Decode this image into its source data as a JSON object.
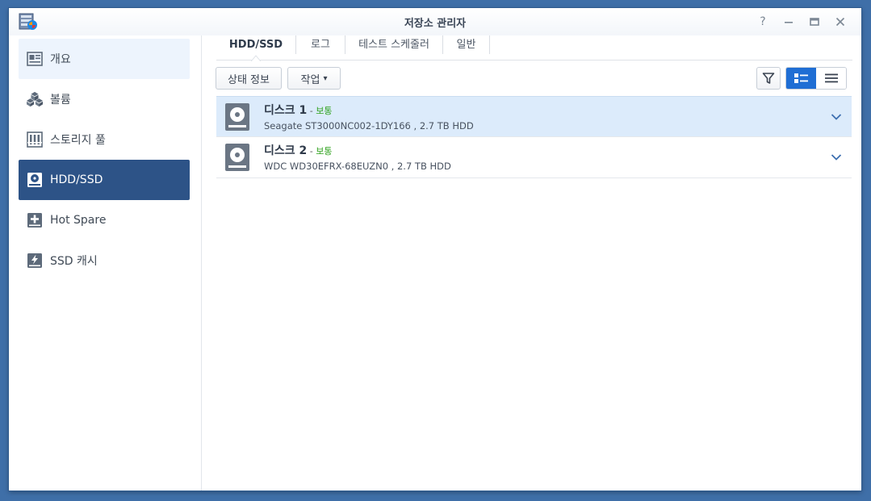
{
  "window": {
    "title": "저장소 관리자",
    "icon": "storage-manager-app-icon",
    "controls": [
      "help-icon",
      "minimize-icon",
      "maximize-icon",
      "close-icon"
    ],
    "help_label": "?"
  },
  "sidebar": {
    "items": [
      {
        "label": "개요",
        "icon": "overview-icon",
        "state": "hover"
      },
      {
        "label": "볼륨",
        "icon": "volume-icon",
        "state": "normal"
      },
      {
        "label": "스토리지 풀",
        "icon": "storage-pool-icon",
        "state": "normal"
      },
      {
        "label": "HDD/SSD",
        "icon": "hdd-icon",
        "state": "active"
      },
      {
        "label": "Hot Spare",
        "icon": "hot-spare-icon",
        "state": "normal"
      },
      {
        "label": "SSD 캐시",
        "icon": "ssd-cache-icon",
        "state": "normal"
      }
    ]
  },
  "tabs": [
    {
      "label": "HDD/SSD",
      "active": true
    },
    {
      "label": "로그",
      "active": false
    },
    {
      "label": "테스트 스케줄러",
      "active": false
    },
    {
      "label": "일반",
      "active": false
    }
  ],
  "toolbar": {
    "status_info_label": "상태 정보",
    "action_label": "작업",
    "action_caret": "▾",
    "filter_icon": "filter-icon",
    "views": [
      {
        "icon": "detail-view-icon",
        "active": true
      },
      {
        "icon": "list-view-icon",
        "active": false
      }
    ]
  },
  "disks": [
    {
      "name_prefix": "디스크",
      "number": "1",
      "separator": " - ",
      "status": "보통",
      "description": "Seagate ST3000NC002-1DY166 , 2.7 TB HDD",
      "selected": true
    },
    {
      "name_prefix": "디스크",
      "number": "2",
      "separator": " - ",
      "status": "보통",
      "description": "WDC WD30EFRX-68EUZN0 , 2.7 TB HDD",
      "selected": false
    }
  ],
  "colors": {
    "desktop": "#3f6fa8",
    "sidebar_active": "#2d5387",
    "sidebar_hover": "#edf4fd",
    "selected_row": "#dcebfb",
    "status_ok": "#2fa21d",
    "view_active": "#1f6ed4"
  }
}
